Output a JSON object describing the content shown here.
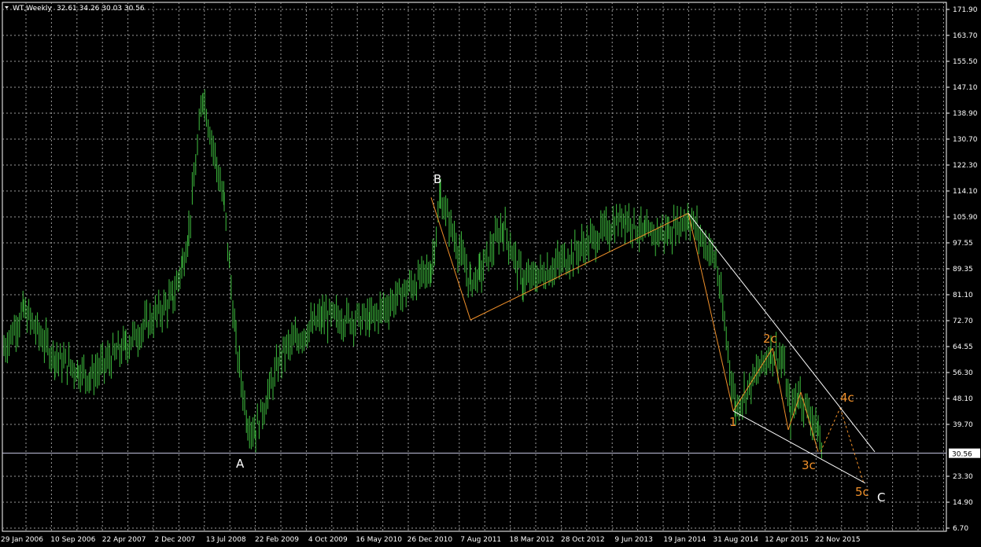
{
  "header": {
    "symbol": "WT,Weekly",
    "ohlc": "32.61 34.26 30.03 30.56"
  },
  "colors": {
    "background": "#000000",
    "grid": "#9a9a9a",
    "candles": "#3fbf3f",
    "wave_line": "#f0902a",
    "trend_line": "#ffffff",
    "price_line": "#c9c9e6",
    "wave_label_orange": "#f0902a",
    "wave_label_white": "#ffffff"
  },
  "chart_data": {
    "type": "line",
    "title": "",
    "xlabel": "",
    "ylabel": "",
    "ylim": [
      6.7,
      171.9
    ],
    "current_price_label": "30.56",
    "y_ticks": [
      "171.90",
      "163.70",
      "155.50",
      "147.10",
      "138.90",
      "130.70",
      "122.30",
      "114.10",
      "105.90",
      "97.55",
      "89.35",
      "81.10",
      "72.70",
      "64.55",
      "56.30",
      "48.10",
      "39.70",
      "30.56",
      "23.30",
      "14.90",
      "6.70"
    ],
    "x_ticks": [
      "29 Jan 2006",
      "10 Sep 2006",
      "22 Apr 2007",
      "2 Dec 2007",
      "13 Jul 2008",
      "22 Feb 2009",
      "4 Oct 2009",
      "16 May 2010",
      "26 Dec 2010",
      "7 Aug 2011",
      "18 Mar 2012",
      "28 Oct 2012",
      "9 Jun 2013",
      "19 Jan 2014",
      "31 Aug 2014",
      "12 Apr 2015",
      "22 Nov 2015"
    ],
    "series": [
      {
        "x": [
          "29 Jan 2006",
          "Jun 2006",
          "10 Sep 2006",
          "Dec 2006",
          "Jan 2007",
          "22 Apr 2007",
          "Sep 2007",
          "2 Dec 2007",
          "Feb 2008",
          "13 Jul 2008",
          "Sep 2008",
          "Nov 2008",
          "Jan 2009",
          "22 Feb 2009",
          "Jun 2009",
          "4 Oct 2009",
          "16 May 2010",
          "26 Dec 2010",
          "Apr 2011",
          "7 Aug 2011",
          "Oct 2011",
          "18 Mar 2012",
          "Jun 2012",
          "28 Oct 2012",
          "9 Jun 2013",
          "Sep 2013",
          "19 Jan 2014",
          "Jun 2014",
          "31 Aug 2014",
          "Jan 2015",
          "12 Apr 2015",
          "Jun 2015",
          "Aug 2015",
          "Oct 2015",
          "22 Nov 2015",
          "Jan 2016"
        ],
        "values": [
          64,
          76,
          61,
          57,
          55,
          65,
          80,
          91,
          101,
          145,
          110,
          65,
          40,
          38,
          63,
          74,
          73,
          89,
          112,
          85,
          88,
          103,
          85,
          89,
          106,
          100,
          101,
          106,
          92,
          45,
          63,
          60,
          43,
          50,
          38,
          30.56
        ]
      }
    ]
  },
  "waves": {
    "labels": [
      "A",
      "B",
      "1",
      "2c",
      "3c",
      "4c",
      "5c",
      "C"
    ]
  }
}
